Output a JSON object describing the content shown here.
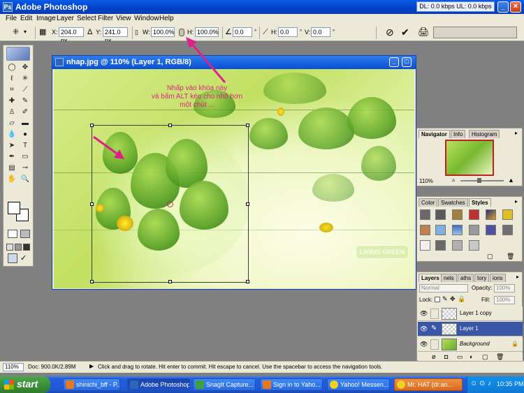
{
  "window": {
    "title": "Adobe Photoshop",
    "app_icon": "photoshop-icon",
    "speed_indicator": "DL: 0.0 kbps  UL: 0.0 kbps"
  },
  "menu": [
    "File",
    "Edit",
    "Image",
    "Layer",
    "Select",
    "Filter",
    "View",
    "Window",
    "Help"
  ],
  "options": {
    "x_label": "X:",
    "x_value": "204.0 px",
    "y_label": "Y:",
    "y_value": "241.0 px",
    "w_label": "W:",
    "w_value": "100.0%",
    "h_label": "H:",
    "h_value": "100.0%",
    "angle_value": "0.0",
    "hskew_label": "H:",
    "hskew_value": "0.0",
    "vskew_label": "V:",
    "vskew_value": "0.0"
  },
  "document": {
    "title": "nhap.jpg @ 110% (Layer 1, RGB/8)",
    "annotation_line1": "Nhấp vào khóa này",
    "annotation_line2": "và bấm ALT kéo cho nhỏ hơn",
    "annotation_line3": "một chút ...",
    "image_label": "LIVING GREEN",
    "annotation_color": "#e0208a"
  },
  "navigator_panel": {
    "tabs": [
      "Navigator",
      "Info",
      "Histogram"
    ],
    "zoom": "110%"
  },
  "styles_panel": {
    "tabs": [
      "Color",
      "Swatches",
      "Styles"
    ]
  },
  "layers_panel": {
    "tabs": [
      "Layers",
      "nels",
      "aths",
      "tory",
      "ions"
    ],
    "blend_mode": "Normal",
    "opacity_label": "Opacity:",
    "opacity_value": "100%",
    "lock_label": "Lock:",
    "fill_label": "Fill:",
    "fill_value": "100%",
    "layers": [
      {
        "name": "Layer 1 copy",
        "selected": false
      },
      {
        "name": "Layer 1",
        "selected": true
      },
      {
        "name": "Background",
        "selected": false
      }
    ]
  },
  "status": {
    "zoom": "110%",
    "doc": "Doc: 900.0K/2.89M",
    "hint": "Click and drag to rotate. Hit enter to commit. Hit escape to cancel. Use the spacebar to access the navigation tools."
  },
  "taskbar": {
    "start_label": "start",
    "items": [
      "shinichi_bff - P...",
      "Adobe Photoshop",
      "SnagIt Capture...",
      "Sign in to Yaho...",
      "Yahoo! Messen...",
      "Mr. HAT (dr.an..."
    ],
    "clock": "10:35 PM"
  }
}
